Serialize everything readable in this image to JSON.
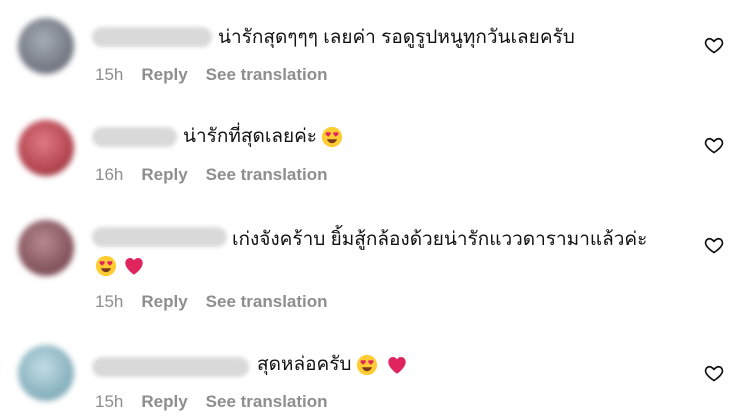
{
  "comments": [
    {
      "text": "น่ารักสุดๆๆๆ เลยค่า รอดูรูปหนูทุกวันเลยครับ",
      "time": "15h",
      "reply": "Reply",
      "translate": "See translation",
      "emojis": [],
      "avatar_color": "#7a7f8a"
    },
    {
      "text": "น่ารักที่สุดเลยค่ะ",
      "time": "16h",
      "reply": "Reply",
      "translate": "See translation",
      "emojis": [
        "smiling-face-with-heart-eyes"
      ],
      "avatar_color": "#b84a55"
    },
    {
      "text": "เก่งจังคร้าบ ยิ้มสู้กล้องด้วยน่ารักแววดารามาแล้วค่ะ",
      "time": "15h",
      "reply": "Reply",
      "translate": "See translation",
      "emojis": [
        "smiling-face-with-heart-eyes",
        "red-heart"
      ],
      "avatar_color": "#8a5a63"
    },
    {
      "text": "สุดหล่อครับ",
      "time": "15h",
      "reply": "Reply",
      "translate": "See translation",
      "emojis": [
        "smiling-face-with-heart-eyes",
        "red-heart"
      ],
      "avatar_color": "#8fb7c4"
    }
  ],
  "colors": {
    "meta": "#8e8e8e",
    "heart_emoji": "#e0245e",
    "emoji_face": "#ffcc33"
  }
}
